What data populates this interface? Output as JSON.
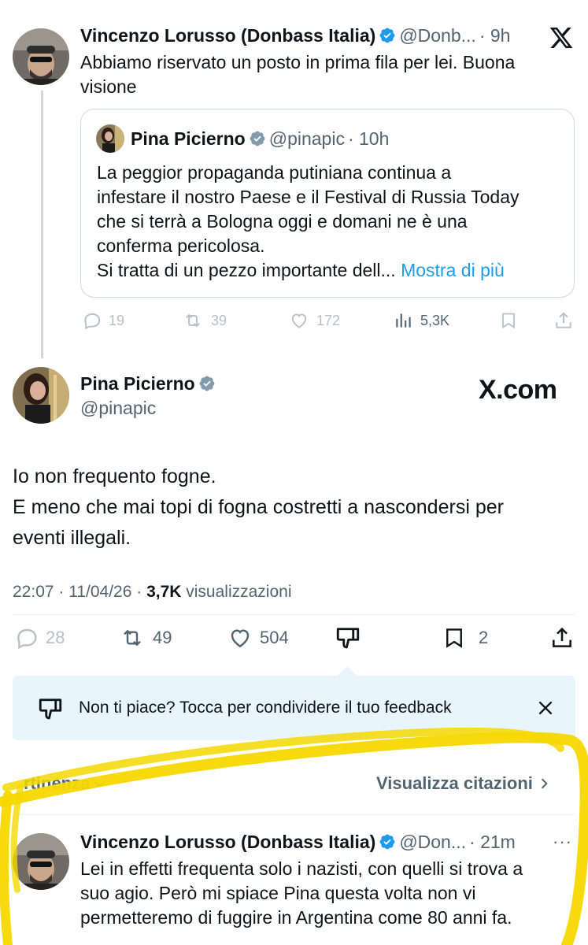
{
  "top_tweet": {
    "author_name": "Vincenzo Lorusso (Donbass Italia)",
    "handle": "@Donb...",
    "time": "· 9h",
    "text_line1": "Abbiamo riservato un posto in prima fila per lei. Buona",
    "text_line2": "visione",
    "brand_icon": "x-logo-icon"
  },
  "quoted_tweet": {
    "author_name": "Pina Picierno",
    "handle": "@pinapic",
    "time": "· 10h",
    "lines": [
      "La peggior propaganda putiniana continua a",
      "infestare il nostro Paese e il Festival di Russia Today",
      "che si terrà a Bologna oggi e domani ne è una",
      "conferma pericolosa.",
      "Si tratta di un pezzo importante dell..."
    ],
    "show_more": "Mostra di più"
  },
  "top_actions": {
    "replies": "19",
    "reposts": "39",
    "likes": "172",
    "views": "5,3K"
  },
  "main_tweet": {
    "author_name": "Pina Picierno",
    "handle": "@pinapic",
    "watermark": "X.com",
    "line1": "Io non frequento fogne.",
    "line2": "E meno che mai topi di fogna costretti a nascondersi per",
    "line3": "eventi illegali.",
    "time": "22:07 · 11/04/26 · ",
    "views_count": "3,7K",
    "views_label": " visualizzazioni"
  },
  "main_actions": {
    "replies": "28",
    "reposts": "49",
    "likes": "504",
    "bookmarks": "2"
  },
  "feedback": {
    "text": "Non ti piace? Tocca per condividere il tuo feedback"
  },
  "replies_bar": {
    "sort_label": "rtinenza",
    "quotes_label": "Visualizza citazioni"
  },
  "reply_tweet": {
    "author_name": "Vincenzo Lorusso (Donbass Italia)",
    "handle": "@Don...",
    "time": "· 21m",
    "line1": "Lei in effetti frequenta solo i nazisti, con quelli si trova a",
    "line2": "suo agio. Però mi spiace Pina questa volta non vi",
    "line3": "permetteremo di fuggire in Argentina come 80 anni fa."
  },
  "colors": {
    "accent": "#1d9bf0",
    "highlight": "#f5d800",
    "feedback_bg": "#e8f5fd"
  }
}
